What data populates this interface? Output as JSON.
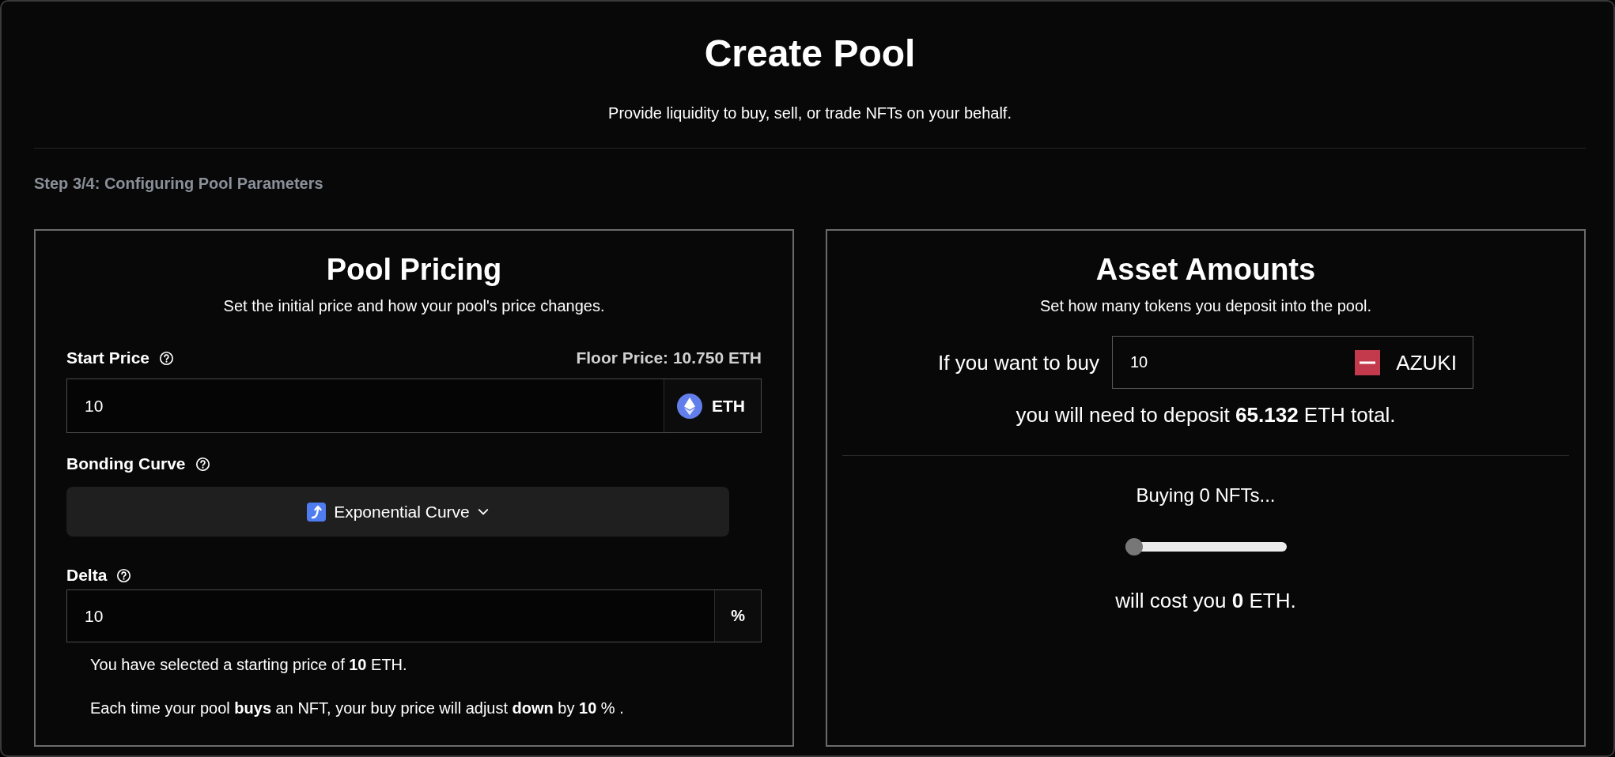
{
  "page": {
    "title": "Create Pool",
    "subtitle": "Provide liquidity to buy, sell, or trade NFTs on your behalf.",
    "step": "Step 3/4: Configuring Pool Parameters"
  },
  "pool_pricing": {
    "title": "Pool Pricing",
    "subtitle": "Set the initial price and how your pool's price changes.",
    "start_price": {
      "label": "Start Price",
      "floor_price": "Floor Price:  10.750 ETH",
      "value": "10",
      "unit": "ETH"
    },
    "bonding_curve": {
      "label": "Bonding Curve",
      "value": "Exponential Curve"
    },
    "delta": {
      "label": "Delta",
      "value": "10",
      "unit": "%"
    },
    "notes": [
      "You have selected a starting price of **10** ETH.",
      "Each time your pool **buys** an NFT, your buy price will adjust **down** by **10** % ."
    ]
  },
  "asset_amounts": {
    "title": "Asset Amounts",
    "subtitle": "Set how many tokens you deposit into the pool.",
    "prompt": "If you want to buy",
    "amount": "10",
    "token": "AZUKI",
    "deposit": "you will need to deposit **65.132** ETH total.",
    "buying": "Buying 0 NFTs...",
    "slider": {
      "level": 0
    },
    "cost": "will cost you **0** ETH."
  }
}
